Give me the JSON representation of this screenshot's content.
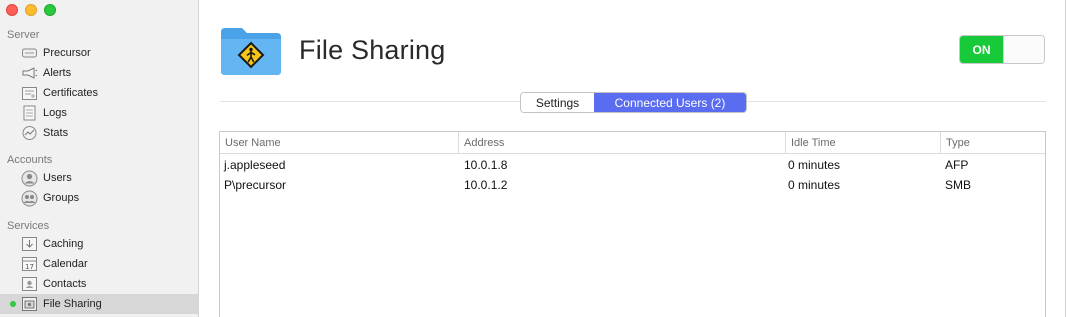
{
  "window": {
    "title": "File Sharing"
  },
  "sidebar": {
    "sections": [
      {
        "header": "Server",
        "items": [
          {
            "label": "Precursor",
            "icon": "server-icon"
          },
          {
            "label": "Alerts",
            "icon": "megaphone-icon"
          },
          {
            "label": "Certificates",
            "icon": "certificate-icon"
          },
          {
            "label": "Logs",
            "icon": "log-document-icon"
          },
          {
            "label": "Stats",
            "icon": "gauge-icon"
          }
        ]
      },
      {
        "header": "Accounts",
        "items": [
          {
            "label": "Users",
            "icon": "user-icon"
          },
          {
            "label": "Groups",
            "icon": "group-icon"
          }
        ]
      },
      {
        "header": "Services",
        "items": [
          {
            "label": "Caching",
            "icon": "caching-icon"
          },
          {
            "label": "Calendar",
            "icon": "calendar-icon",
            "calendar_day": "17"
          },
          {
            "label": "Contacts",
            "icon": "contacts-icon"
          },
          {
            "label": "File Sharing",
            "icon": "file-sharing-icon",
            "selected": true,
            "status": "running"
          }
        ]
      }
    ]
  },
  "main": {
    "title": "File Sharing",
    "service_icon": "shared-folder-icon",
    "toggle": {
      "label": "ON",
      "state": "on",
      "color": "#18c93a"
    },
    "tabs": [
      {
        "label": "Settings",
        "selected": false
      },
      {
        "label": "Connected Users (2)",
        "selected": true
      }
    ],
    "table": {
      "columns": [
        "User Name",
        "Address",
        "Idle Time",
        "Type"
      ],
      "rows": [
        [
          "j.appleseed",
          "10.0.1.8",
          "0 minutes",
          "AFP"
        ],
        [
          "P\\precursor",
          "10.0.1.2",
          "0 minutes",
          "SMB"
        ]
      ]
    }
  },
  "colors": {
    "accent_tab": "#5a6cf0",
    "status_dot": "#2fc946",
    "toggle_on": "#18c93a"
  }
}
